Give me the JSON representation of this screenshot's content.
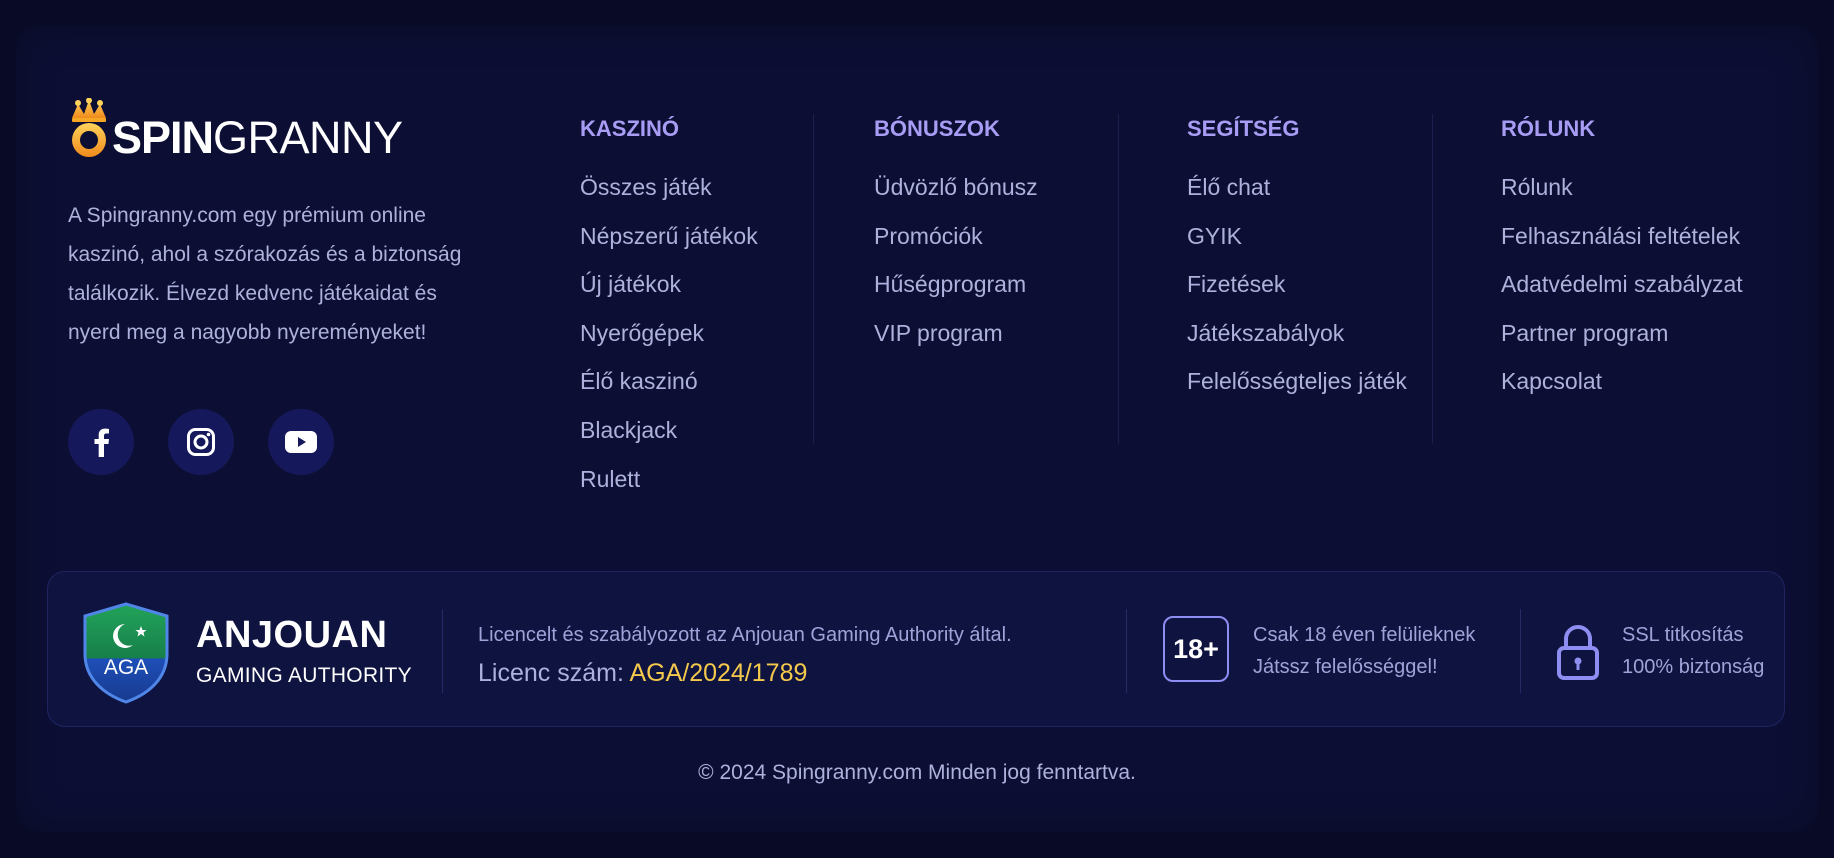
{
  "brand": {
    "logo_spin": "SPIN",
    "logo_granny": "GRANNY",
    "description": "A Spingranny.com egy prémium online kaszinó, ahol a szórakozás és a biztonság találkozik. Élvezd kedvenc játékaidat és nyerd meg a nagyobb nyereményeket!"
  },
  "socials": [
    {
      "icon": "facebook-icon"
    },
    {
      "icon": "instagram-icon"
    },
    {
      "icon": "youtube-icon"
    }
  ],
  "columns": [
    {
      "title": "KASZINÓ",
      "links": [
        "Összes játék",
        "Népszerű játékok",
        "Új játékok",
        "Nyerőgépek",
        "Élő kaszinó",
        "Blackjack",
        "Rulett"
      ]
    },
    {
      "title": "BÓNUSZOK",
      "links": [
        "Üdvözlő bónusz",
        "Promóciók",
        "Hűségprogram",
        "VIP program"
      ]
    },
    {
      "title": "SEGÍTSÉG",
      "links": [
        "Élő chat",
        "GYIK",
        "Fizetések",
        "Játékszabályok",
        "Felelősségteljes játék"
      ]
    },
    {
      "title": "RÓLUNK",
      "links": [
        "Rólunk",
        "Felhasználási feltételek",
        "Adatvédelmi szabályzat",
        "Partner program",
        "Kapcsolat"
      ]
    }
  ],
  "license": {
    "shield_text": "AGA",
    "authority_title": "ANJOUAN",
    "authority_subtitle": "GAMING AUTHORITY",
    "licensed_text": "Licencelt és szabályozott az Anjouan Gaming Authority által.",
    "license_label": "Licenc szám: ",
    "license_number": "AGA/2024/1789",
    "age_badge": "18+",
    "age_line1": "Csak 18 éven felülieknek",
    "age_line2": "Játssz felelősséggel!",
    "ssl_line1": "SSL titkosítás",
    "ssl_line2": "100% biztonság"
  },
  "copyright": "© 2024 Spingranny.com Minden jog fenntartva.",
  "colors": {
    "background": "#080a26",
    "panel": "#0c0f33",
    "heading": "#a89cf4",
    "text": "#aeb1dc",
    "accent_gold": "#f4c94c",
    "badge_border": "#8e8ef2"
  }
}
